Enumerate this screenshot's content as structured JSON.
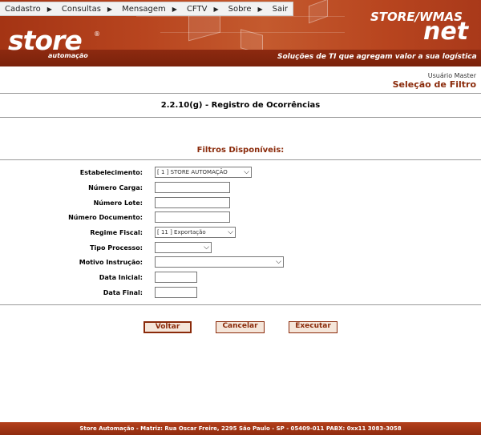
{
  "menu": {
    "items": [
      {
        "label": "Cadastro"
      },
      {
        "label": "Consultas"
      },
      {
        "label": "Mensagem"
      },
      {
        "label": "CFTV"
      },
      {
        "label": "Sobre"
      },
      {
        "label": "Sair"
      }
    ]
  },
  "banner": {
    "logo_text": "store",
    "logo_reg": "®",
    "logo_sub": "automação",
    "brand_line1": "STORE/WMAS",
    "brand_line2": "net",
    "tagline": "Soluções de TI que agregam valor a sua logística"
  },
  "header": {
    "user": "Usuário Master",
    "page_heading": "Seleção de Filtro"
  },
  "page": {
    "title": "2.2.10(g) - Registro de Ocorrências",
    "filters_title": "Filtros Disponíveis:"
  },
  "form": {
    "estabelecimento": {
      "label": "Estabelecimento:",
      "value": "[ 1 ] STORE AUTOMAÇÃO"
    },
    "numero_carga": {
      "label": "Número Carga:",
      "value": ""
    },
    "numero_lote": {
      "label": "Número Lote:",
      "value": ""
    },
    "numero_documento": {
      "label": "Número Documento:",
      "value": ""
    },
    "regime_fiscal": {
      "label": "Regime Fiscal:",
      "value": "[ 11 ] Exportação"
    },
    "tipo_processo": {
      "label": "Tipo Processo:",
      "value": ""
    },
    "motivo_instrucao": {
      "label": "Motivo Instrução:",
      "value": ""
    },
    "data_inicial": {
      "label": "Data Inicial:",
      "value": ""
    },
    "data_final": {
      "label": "Data Final:",
      "value": ""
    }
  },
  "buttons": {
    "voltar": "Voltar",
    "cancelar": "Cancelar",
    "executar": "Executar"
  },
  "footer": {
    "text": "Store Automação - Matriz: Rua Oscar Freire, 2295 São Paulo - SP - 05409-011 PABX: 0xx11 3083-3058"
  },
  "colors": {
    "banner": "#b8451f",
    "accent": "#8a2a0a",
    "button_bg": "#f5e6da"
  }
}
